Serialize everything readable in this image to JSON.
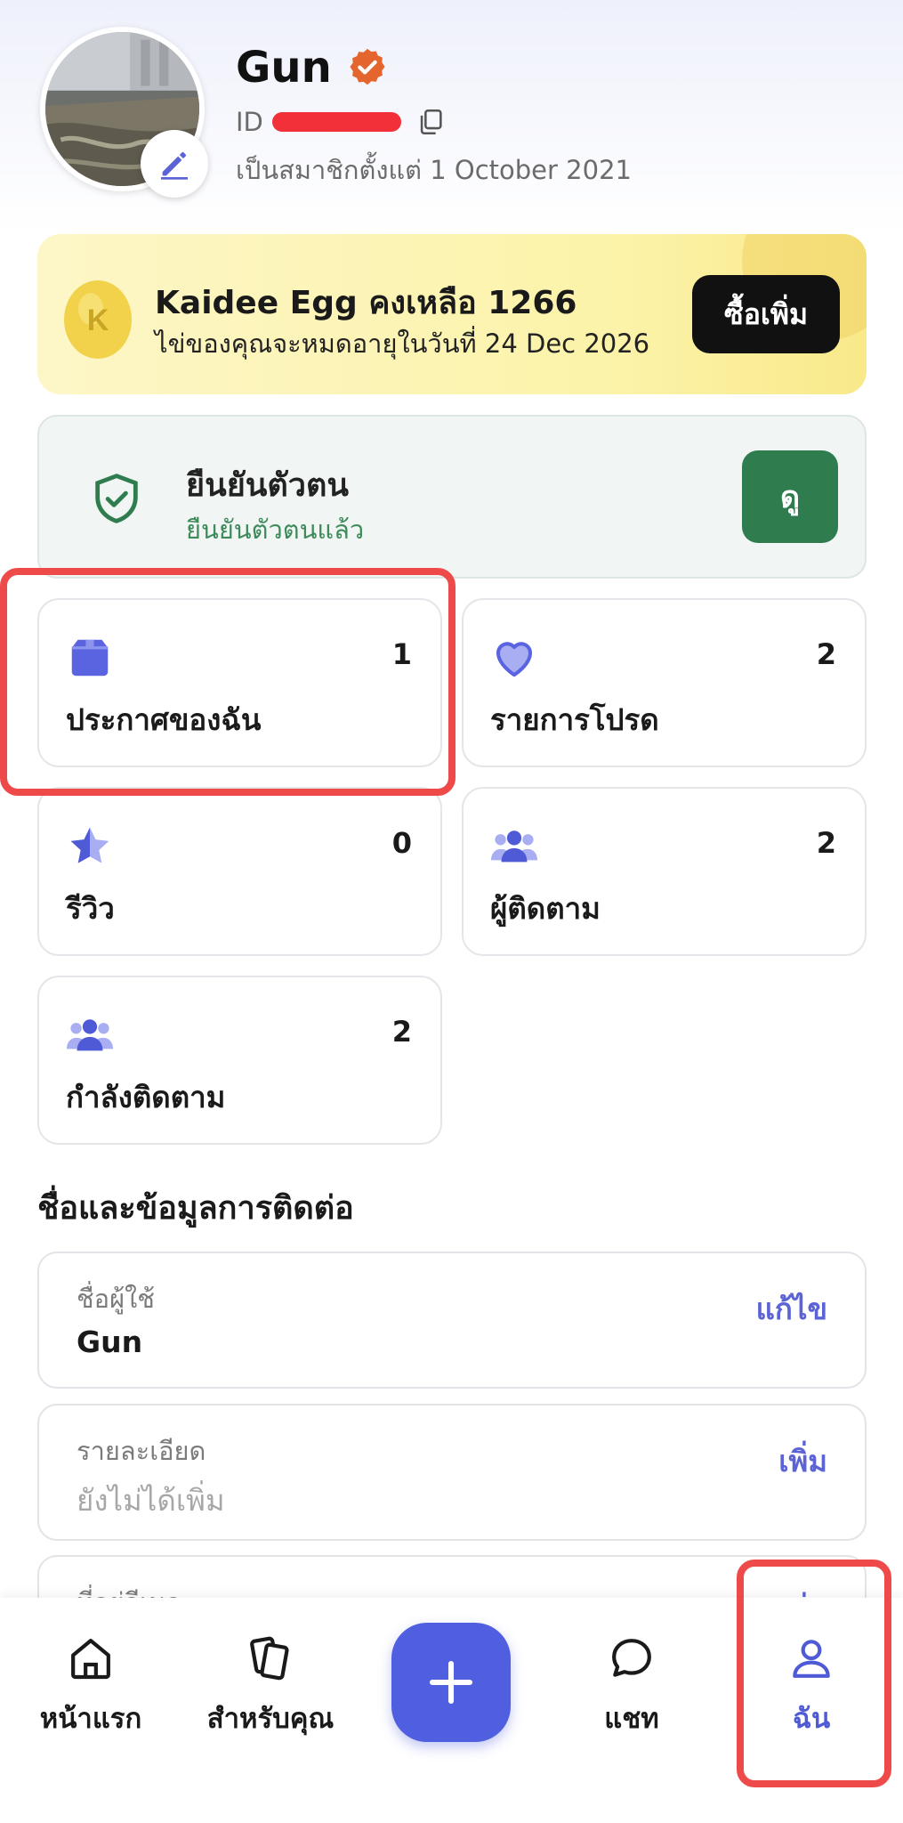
{
  "profile": {
    "name": "Gun",
    "id_label": "ID",
    "member_since": "เป็นสมาชิกตั้งแต่ 1 October 2021"
  },
  "egg": {
    "title": "Kaidee Egg คงเหลือ 1266",
    "subtitle": "ไข่ของคุณจะหมดอายุในวันที่ 24 Dec 2026",
    "buy_label": "ซื้อเพิ่ม",
    "egg_letter": "K"
  },
  "verify": {
    "title": "ยืนยันตัวตน",
    "status": "ยืนยันตัวตนแล้ว",
    "view_label": "ดู"
  },
  "stats": [
    {
      "label": "ประกาศของฉัน",
      "count": "1",
      "icon": "box-icon"
    },
    {
      "label": "รายการโปรด",
      "count": "2",
      "icon": "heart-icon"
    },
    {
      "label": "รีวิว",
      "count": "0",
      "icon": "star-icon"
    },
    {
      "label": "ผู้ติดตาม",
      "count": "2",
      "icon": "people-icon"
    },
    {
      "label": "กำลังติดตาม",
      "count": "2",
      "icon": "people-icon"
    }
  ],
  "contact": {
    "section_title": "ชื่อและข้อมูลการติดต่อ",
    "fields": [
      {
        "label": "ชื่อผู้ใช้",
        "value": "Gun",
        "action": "แก้ไข"
      },
      {
        "label": "รายละเอียด",
        "value": "ยังไม่ได้เพิ่ม",
        "action": "เพิ่ม"
      },
      {
        "label": "ที่อยู่อีเมล",
        "value": "",
        "action": "เพิ่ม"
      }
    ]
  },
  "nav": {
    "home": "หน้าแรก",
    "for_you": "สำหรับคุณ",
    "chat": "แชท",
    "me": "ฉัน"
  },
  "colors": {
    "accent": "#4f5ad6",
    "verify_green": "#2f7d4f",
    "highlight_red": "#ef4a4a",
    "verified_badge": "#e5652f"
  }
}
